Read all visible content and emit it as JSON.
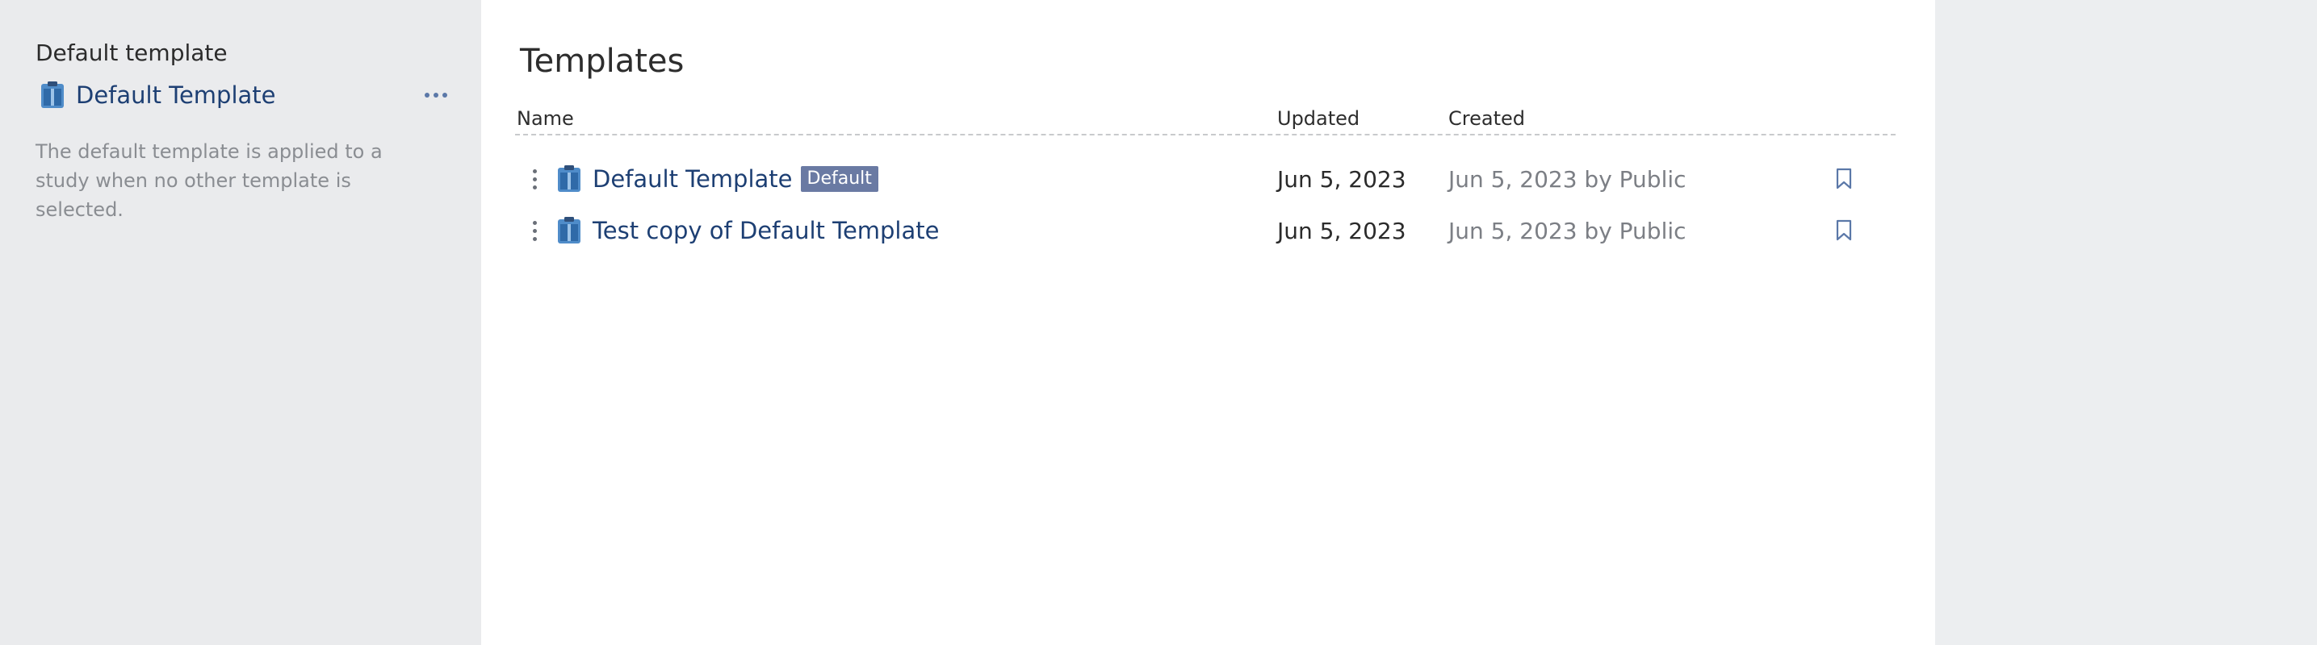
{
  "sidebar": {
    "heading": "Default template",
    "template_link": "Default Template",
    "description": "The default template is applied to a study when no other template is selected.",
    "icons": {
      "template": "clipboard-template-icon",
      "more": "more-horizontal-icon"
    }
  },
  "main": {
    "title": "Templates",
    "columns": {
      "name": "Name",
      "updated": "Updated",
      "created": "Created"
    },
    "rows": [
      {
        "name": "Default Template",
        "badge": "Default",
        "updated": "Jun 5, 2023",
        "created": "Jun 5, 2023 by Public"
      },
      {
        "name": "Test copy of Default Template",
        "badge": "",
        "updated": "Jun 5, 2023",
        "created": "Jun 5, 2023 by Public"
      }
    ],
    "icons": {
      "row_menu": "more-vertical-icon",
      "template": "clipboard-template-icon",
      "bookmark": "bookmark-icon"
    }
  },
  "colors": {
    "link": "#1d3f73",
    "badge_bg": "#6a7aa3",
    "icon_blue": "#4f8cc9",
    "sidebar_bg": "#eaebed"
  }
}
